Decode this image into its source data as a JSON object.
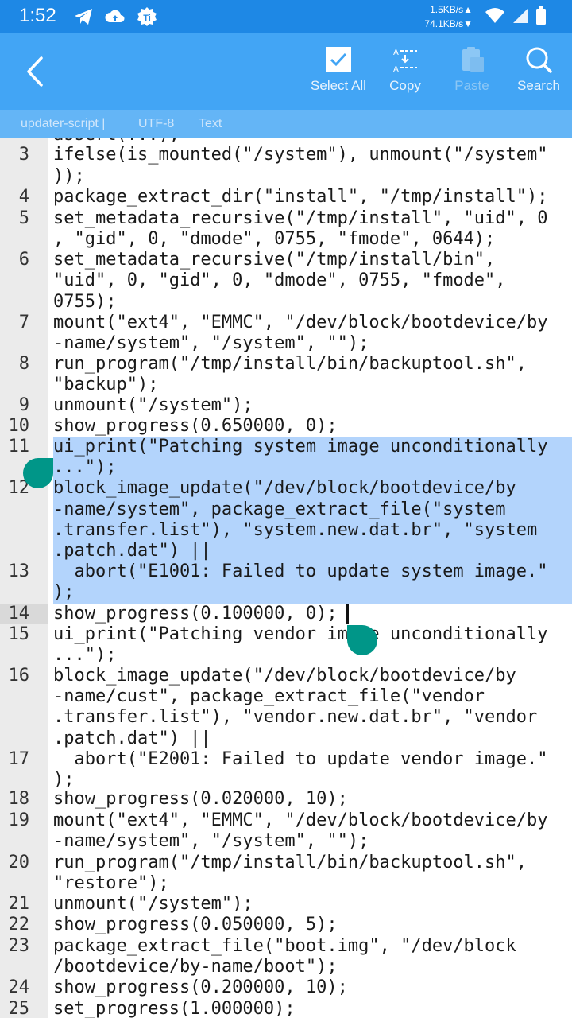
{
  "status_bar": {
    "time": "1:52",
    "upload_speed": "1.5KB/s▲",
    "download_speed": "74.1KB/s▼",
    "icons": [
      "telegram-icon",
      "cloud-upload-icon",
      "ti-app-icon",
      "wifi-icon",
      "signal-icon",
      "battery-icon"
    ]
  },
  "toolbar": {
    "back_icon": "arrow-back-icon",
    "select_all_label": "Select All",
    "copy_label": "Copy",
    "paste_label": "Paste",
    "search_label": "Search"
  },
  "file_info": {
    "filename": "updater-script |",
    "encoding": "UTF-8",
    "mode": "Text"
  },
  "editor": {
    "current_line": "14",
    "gutter_numbers": [
      "3",
      "4",
      "5",
      "6",
      "7",
      "8",
      "9",
      "10",
      "11",
      "12",
      "13",
      "14",
      "15",
      "16",
      "17",
      "18",
      "19",
      "20",
      "21",
      "22",
      "23",
      "24",
      "25"
    ],
    "lines": [
      "assert(...);",
      "ifelse(is_mounted(\"/system\"), unmount(\"/system\"",
      "));",
      "package_extract_dir(\"install\", \"/tmp/install\");",
      "set_metadata_recursive(\"/tmp/install\", \"uid\", 0",
      ", \"gid\", 0, \"dmode\", 0755, \"fmode\", 0644);",
      "set_metadata_recursive(\"/tmp/install/bin\",",
      "\"uid\", 0, \"gid\", 0, \"dmode\", 0755, \"fmode\",",
      "0755);",
      "mount(\"ext4\", \"EMMC\", \"/dev/block/bootdevice/by",
      "-name/system\", \"/system\", \"\");",
      "run_program(\"/tmp/install/bin/backuptool.sh\",",
      "\"backup\");",
      "unmount(\"/system\");",
      "show_progress(0.650000, 0);",
      "ui_print(\"Patching system image unconditionally",
      "...\");",
      "block_image_update(\"/dev/block/bootdevice/by",
      "-name/system\", package_extract_file(\"system",
      ".transfer.list\"), \"system.new.dat.br\", \"system",
      ".patch.dat\") ||",
      "  abort(\"E1001: Failed to update system image.\"",
      ");",
      "show_progress(0.100000, 0);",
      "ui_print(\"Patching vendor image unconditionally",
      "...\");",
      "block_image_update(\"/dev/block/bootdevice/by",
      "-name/cust\", package_extract_file(\"vendor",
      ".transfer.list\"), \"vendor.new.dat.br\", \"vendor",
      ".patch.dat\") ||",
      "  abort(\"E2001: Failed to update vendor image.\"",
      ");",
      "show_progress(0.020000, 10);",
      "mount(\"ext4\", \"EMMC\", \"/dev/block/bootdevice/by",
      "-name/system\", \"/system\", \"\");",
      "run_program(\"/tmp/install/bin/backuptool.sh\",",
      "\"restore\");",
      "unmount(\"/system\");",
      "show_progress(0.050000, 5);",
      "package_extract_file(\"boot.img\", \"/dev/block",
      "/bootdevice/by-name/boot\");",
      "show_progress(0.200000, 10);",
      "set_progress(1.000000);"
    ]
  },
  "colors": {
    "status_bar": "#1e88e5",
    "toolbar": "#42a5f5",
    "info_bar": "#64b5f6",
    "selection": "#b3d4fc",
    "handle": "#009688"
  }
}
